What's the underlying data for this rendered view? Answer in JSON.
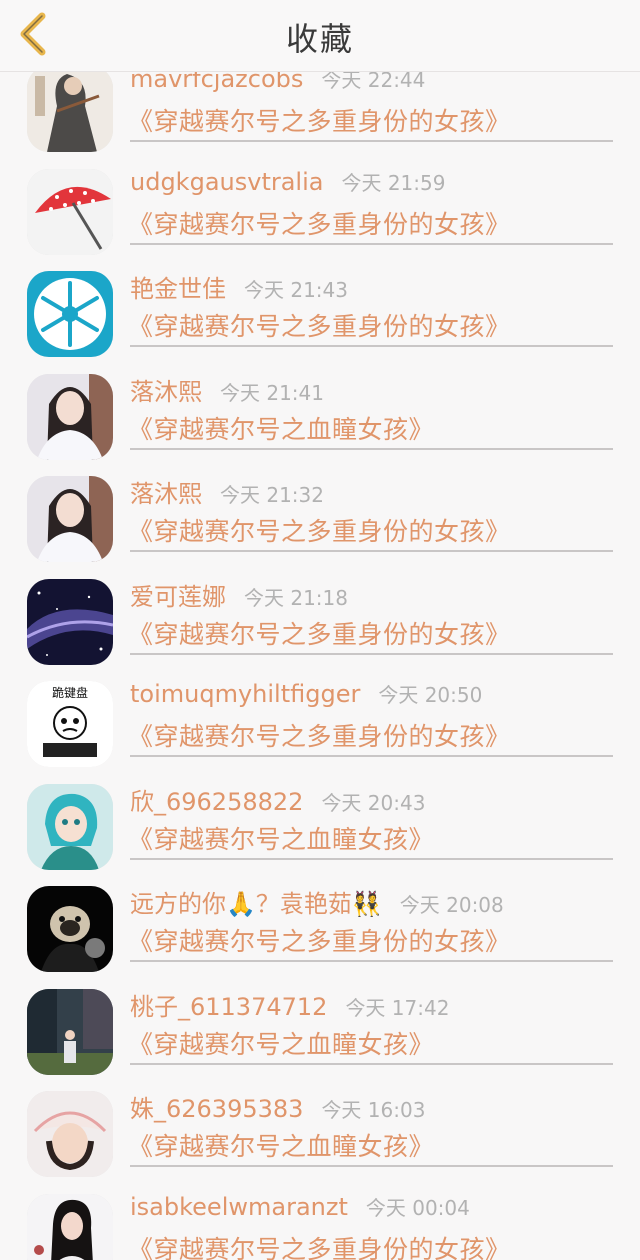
{
  "header": {
    "title": "收藏",
    "back_icon": "chevron-left-icon",
    "accent": "#e8b64c"
  },
  "colors": {
    "name": "#e0956a",
    "time": "#b2b2b2",
    "divider": "#c9c6c6"
  },
  "items": [
    {
      "name": "mavrfcjazcobs",
      "time": "今天 22:44",
      "book": "《穿越赛尔号之多重身份的女孩》",
      "avatar": "avatar-warrior"
    },
    {
      "name": "udgkgausvtralia",
      "time": "今天 21:59",
      "book": "《穿越赛尔号之多重身份的女孩》",
      "avatar": "avatar-umbrella"
    },
    {
      "name": "艳金世佳",
      "time": "今天 21:43",
      "book": "《穿越赛尔号之多重身份的女孩》",
      "avatar": "avatar-snowflake"
    },
    {
      "name": "落沐熙",
      "time": "今天 21:41",
      "book": "《穿越赛尔号之血瞳女孩》",
      "avatar": "avatar-girl"
    },
    {
      "name": "落沐熙",
      "time": "今天 21:32",
      "book": "《穿越赛尔号之多重身份的女孩》",
      "avatar": "avatar-girl"
    },
    {
      "name": "爱可莲娜",
      "time": "今天 21:18",
      "book": "《穿越赛尔号之多重身份的女孩》",
      "avatar": "avatar-galaxy"
    },
    {
      "name": "toimuqmyhiltfigger",
      "time": "今天 20:50",
      "book": "《穿越赛尔号之多重身份的女孩》",
      "avatar": "avatar-meme"
    },
    {
      "name": "欣_696258822",
      "time": "今天 20:43",
      "book": "《穿越赛尔号之血瞳女孩》",
      "avatar": "avatar-anime"
    },
    {
      "name": "远方的你🙏？袁艳茹👯",
      "time": "今天 20:08",
      "book": "《穿越赛尔号之多重身份的女孩》",
      "avatar": "avatar-dog"
    },
    {
      "name": "桃子_611374712",
      "time": "今天 17:42",
      "book": "《穿越赛尔号之血瞳女孩》",
      "avatar": "avatar-street"
    },
    {
      "name": "姝_626395383",
      "time": "今天 16:03",
      "book": "《穿越赛尔号之血瞳女孩》",
      "avatar": "avatar-hat"
    },
    {
      "name": "isabkeelwmaranzt",
      "time": "今天 00:04",
      "book": "《穿越赛尔号之多重身份的女孩》",
      "avatar": "avatar-selfie"
    }
  ]
}
